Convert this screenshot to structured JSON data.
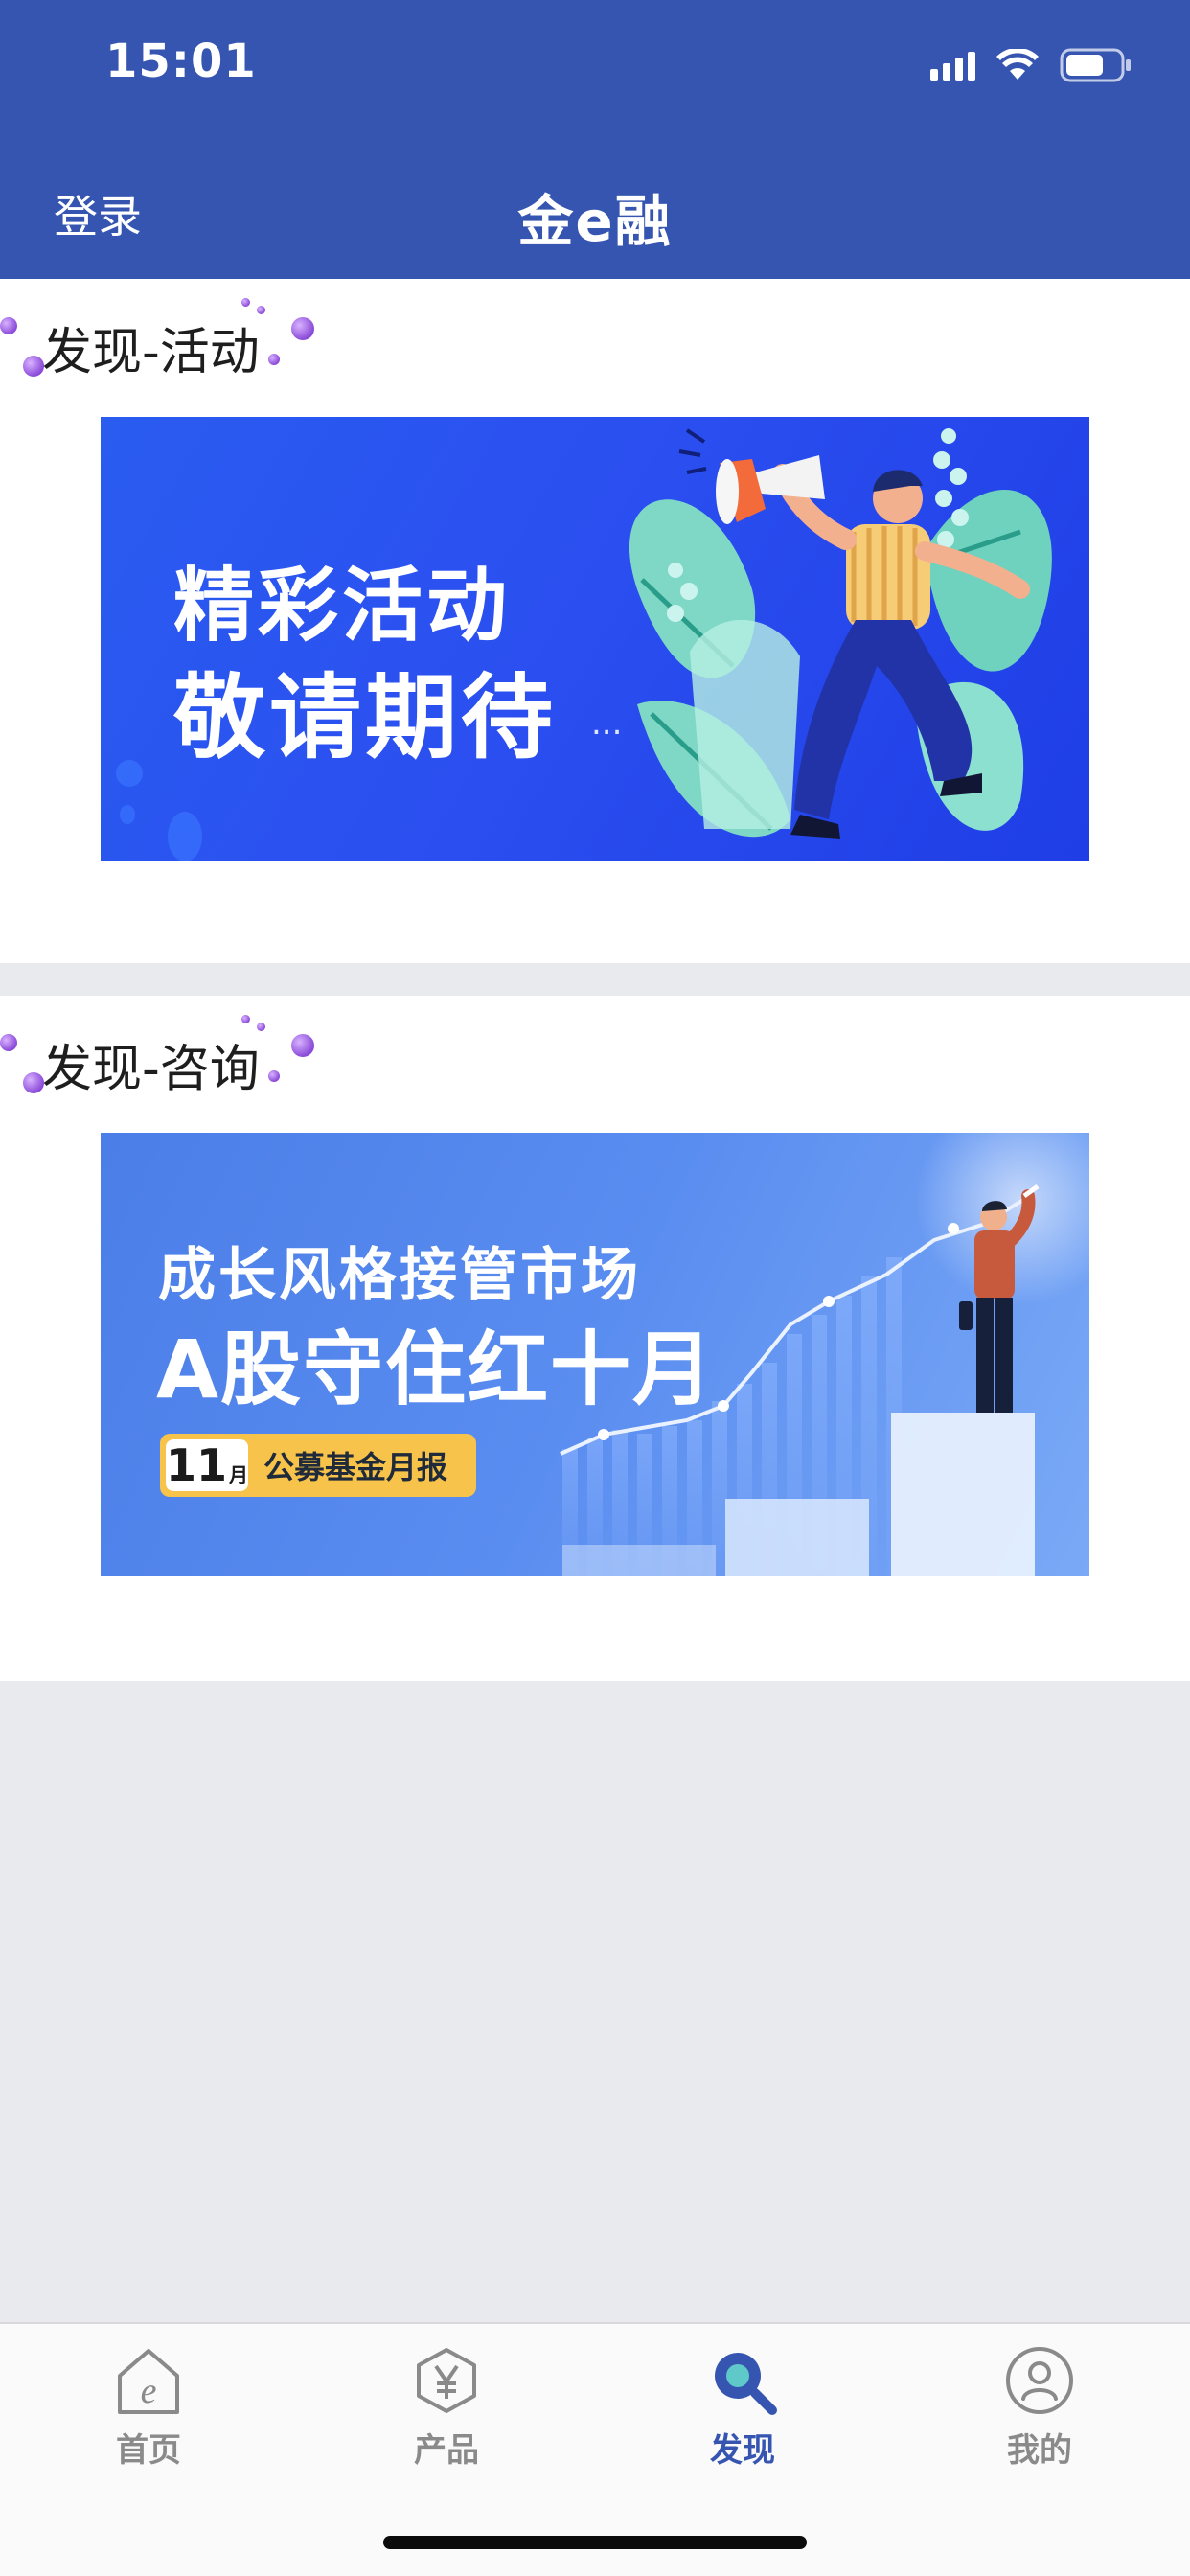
{
  "status_bar": {
    "time": "15:01"
  },
  "header": {
    "login_label": "登录",
    "title": "金e融"
  },
  "sections": [
    {
      "title": "发现-活动",
      "banner": {
        "line1": "精彩活动",
        "line2": "敬请期待",
        "ellipsis": "..."
      }
    },
    {
      "title": "发现-咨询",
      "banner": {
        "line1": "成长风格接管市场",
        "line2": "A股守住红十月",
        "badge_number": "11",
        "badge_month": "月",
        "badge_text": "公募基金月报"
      }
    }
  ],
  "tabbar": {
    "active_color": "#3555b1",
    "inactive_color": "#8a8a8a",
    "tabs": [
      {
        "label": "首页",
        "icon": "home-e-icon"
      },
      {
        "label": "产品",
        "icon": "yen-hexagon-icon"
      },
      {
        "label": "发现",
        "icon": "search-icon",
        "active": true
      },
      {
        "label": "我的",
        "icon": "user-icon"
      }
    ]
  },
  "colors": {
    "brand_blue": "#3555b1",
    "page_bg": "#e9eaee"
  }
}
